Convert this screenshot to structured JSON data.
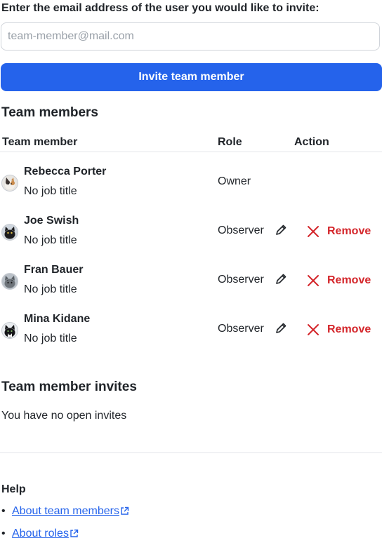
{
  "invite": {
    "label": "Enter the email address of the user you would like to invite:",
    "email_value": "",
    "email_placeholder": "team-member@mail.com",
    "button_label": "Invite team member"
  },
  "members": {
    "heading": "Team members",
    "columns": {
      "member": "Team member",
      "role": "Role",
      "action": "Action"
    },
    "rows": [
      {
        "name": "Rebecca Porter",
        "title": "No job title",
        "role": "Owner",
        "avatar_icon": "cat-avatar-calico"
      },
      {
        "name": "Joe Swish",
        "title": "No job title",
        "role": "Observer",
        "avatar_icon": "cat-avatar-black",
        "remove_label": "Remove"
      },
      {
        "name": "Fran Bauer",
        "title": "No job title",
        "role": "Observer",
        "avatar_icon": "cat-avatar-grey",
        "remove_label": "Remove"
      },
      {
        "name": "Mina Kidane",
        "title": "No job title",
        "role": "Observer",
        "avatar_icon": "cat-avatar-tuxedo",
        "remove_label": "Remove"
      }
    ]
  },
  "invites": {
    "heading": "Team member invites",
    "empty_text": "You have no open invites"
  },
  "help": {
    "heading": "Help",
    "links": [
      {
        "label": "About team members",
        "icon": "external-link-icon"
      },
      {
        "label": "About roles",
        "icon": "external-link-icon"
      }
    ]
  },
  "colors": {
    "primary": "#2563eb",
    "danger": "#d4262b",
    "text": "#1f2328",
    "border": "#d0d4da"
  }
}
